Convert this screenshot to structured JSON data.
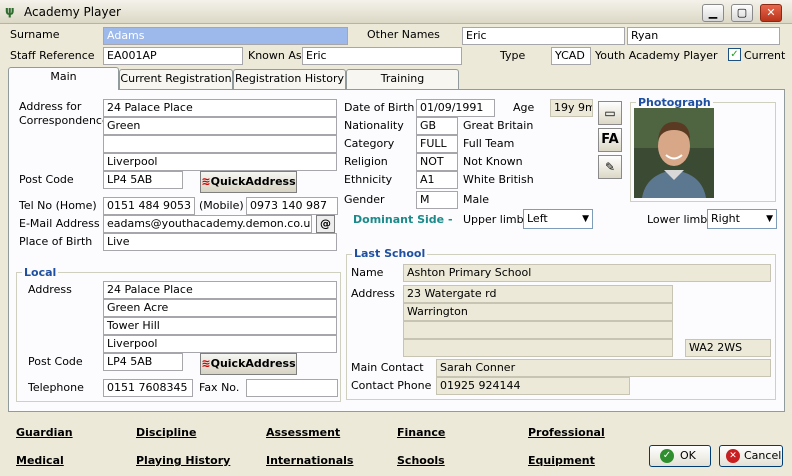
{
  "window": {
    "title": "Academy Player"
  },
  "header": {
    "surname_label": "Surname",
    "surname": "Adams",
    "other_names_label": "Other Names",
    "other_name_1": "Eric",
    "other_name_2": "Ryan",
    "staff_ref_label": "Staff Reference",
    "staff_ref": "EA001AP",
    "known_as_label": "Known As",
    "known_as": "Eric",
    "type_label": "Type",
    "type_code": "YCAD",
    "type_desc": "Youth Academy Player",
    "current_label": "Current",
    "current_checked": true
  },
  "tabs": [
    {
      "label": "Main",
      "active": true
    },
    {
      "label": "Current Registration"
    },
    {
      "label": "Registration History"
    },
    {
      "label": "Training"
    }
  ],
  "address": {
    "label": "Address for Correspondence",
    "lines": [
      "24 Palace Place",
      "Green",
      "",
      "Liverpool"
    ],
    "postcode_label": "Post Code",
    "postcode": "LP4 5AB",
    "quick_address": "QuickAddress",
    "tel_label": "Tel No (Home)",
    "tel": "0151 484 9053",
    "mobile_label": "(Mobile)",
    "mobile": "0973 140 987",
    "email_label": "E-Mail Address",
    "email": "eadams@youthacademy.demon.co.uk",
    "pob_label": "Place of Birth",
    "pob": "Live"
  },
  "local": {
    "title": "Local",
    "address_label": "Address",
    "lines": [
      "24 Palace Place",
      "Green Acre",
      "Tower Hill",
      "Liverpool"
    ],
    "postcode_label": "Post Code",
    "postcode": "LP4 5AB",
    "quick_address": "QuickAddress",
    "tel_label": "Telephone",
    "tel": "0151 7608345",
    "fax_label": "Fax No.",
    "fax": ""
  },
  "personal": {
    "dob_label": "Date of Birth",
    "dob": "01/09/1991",
    "age_label": "Age",
    "age": "19y 9m",
    "nationality_label": "Nationality",
    "nationality_code": "GB",
    "nationality": "Great Britain",
    "category_label": "Category",
    "category_code": "FULL",
    "category": "Full Team",
    "religion_label": "Religion",
    "religion_code": "NOT",
    "religion": "Not Known",
    "ethnicity_label": "Ethnicity",
    "ethnicity_code": "A1",
    "ethnicity": "White British",
    "gender_label": "Gender",
    "gender_code": "M",
    "gender": "Male",
    "fa_label": "FA"
  },
  "dominant": {
    "title": "Dominant Side -",
    "upper_label": "Upper limb",
    "upper": "Left",
    "lower_label": "Lower limb",
    "lower": "Right"
  },
  "photo": {
    "title": "Photograph"
  },
  "school": {
    "title": "Last School",
    "name_label": "Name",
    "name": "Ashton Primary School",
    "address_label": "Address",
    "lines": [
      "23 Watergate rd",
      "Warrington",
      "",
      ""
    ],
    "postcode": "WA2 2WS",
    "contact_label": "Main Contact",
    "contact": "Sarah Conner",
    "phone_label": "Contact Phone",
    "phone": "01925 924144"
  },
  "links": [
    "Guardian",
    "Discipline",
    "Assessment",
    "Finance",
    "Professional",
    "Medical",
    "Playing History",
    "Internationals",
    "Schools",
    "Equipment"
  ],
  "buttons": {
    "ok": "OK",
    "cancel": "Cancel"
  }
}
